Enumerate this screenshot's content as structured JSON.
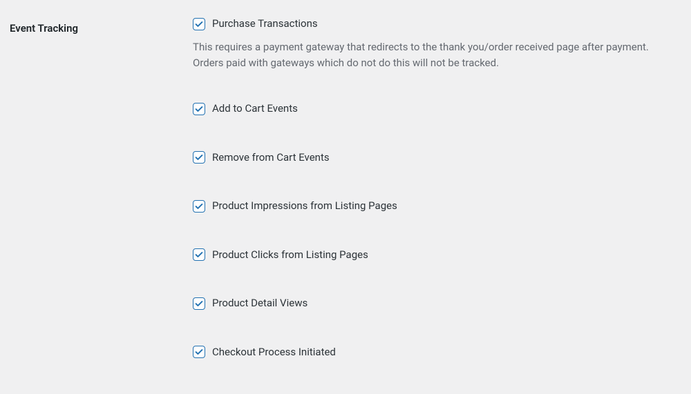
{
  "section": {
    "title": "Event Tracking"
  },
  "options": {
    "purchase": {
      "label": "Purchase Transactions",
      "description": "This requires a payment gateway that redirects to the thank you/order received page after payment. Orders paid with gateways which do not do this will not be tracked."
    },
    "add_to_cart": {
      "label": "Add to Cart Events"
    },
    "remove_from_cart": {
      "label": "Remove from Cart Events"
    },
    "product_impressions": {
      "label": "Product Impressions from Listing Pages"
    },
    "product_clicks": {
      "label": "Product Clicks from Listing Pages"
    },
    "product_detail": {
      "label": "Product Detail Views"
    },
    "checkout_initiated": {
      "label": "Checkout Process Initiated"
    }
  }
}
